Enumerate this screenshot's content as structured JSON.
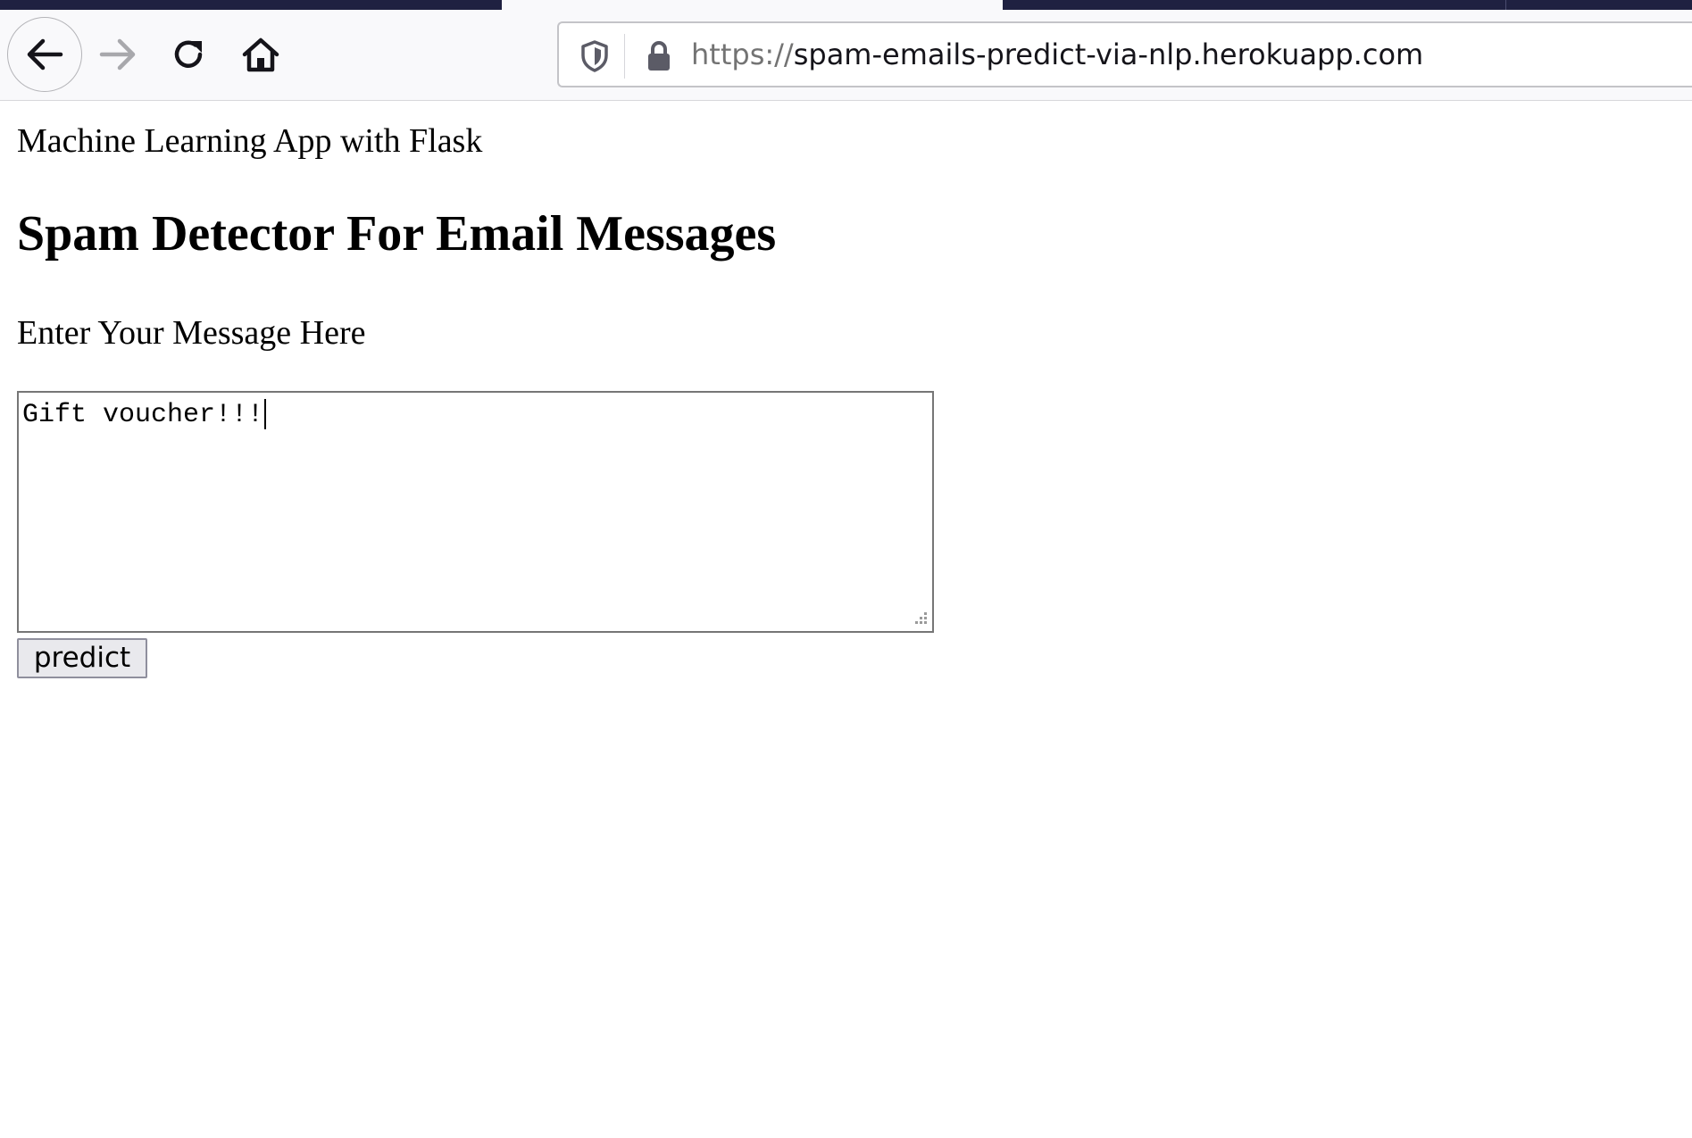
{
  "browser": {
    "url_scheme": "https://",
    "url_host": "spam-emails-predict-via-nlp.herokuapp.com",
    "icons": {
      "back": "arrow-left-icon",
      "forward": "arrow-right-icon",
      "reload": "reload-icon",
      "home": "home-icon",
      "tracking": "shield-icon",
      "security": "lock-icon"
    },
    "colors": {
      "tabstrip": "#1f2141",
      "toolbar": "#f9f9fb",
      "url_scheme": "#737373"
    }
  },
  "page": {
    "subtitle": "Machine Learning App with Flask",
    "title": "Spam Detector For Email Messages",
    "field_label": "Enter Your Message Here",
    "message_value": "Gift voucher!!!",
    "submit_label": "predict"
  }
}
